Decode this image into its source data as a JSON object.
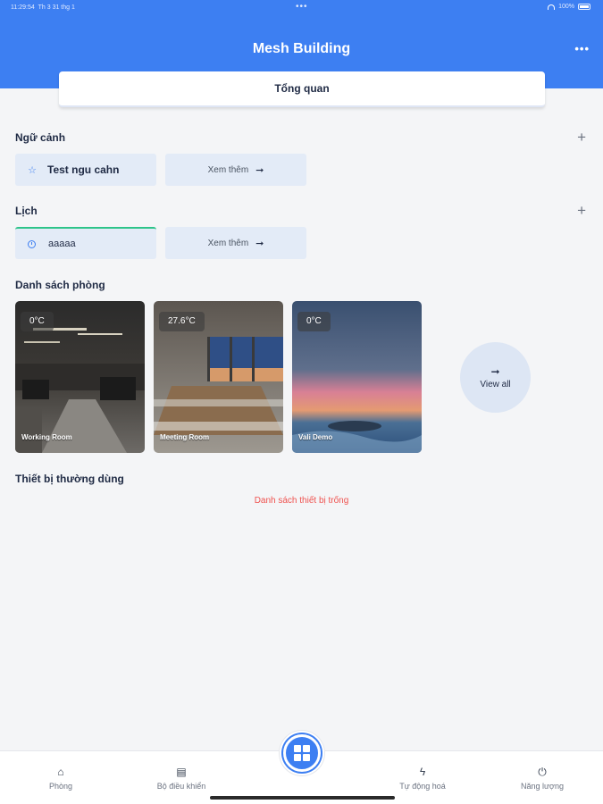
{
  "status_bar": {
    "time": "11:29:54",
    "date": "Th 3 31 thg 1",
    "battery": "100%"
  },
  "header": {
    "title": "Mesh Building"
  },
  "tab": {
    "label": "Tổng quan"
  },
  "scenes": {
    "title": "Ngữ cảnh",
    "item_label": "Test ngu cahn",
    "more_label": "Xem thêm"
  },
  "schedule": {
    "title": "Lịch",
    "item_label": "aaaaa",
    "more_label": "Xem thêm"
  },
  "rooms": {
    "title": "Danh sách phòng",
    "items": [
      {
        "temp": "0°C",
        "name": "Working Room"
      },
      {
        "temp": "27.6°C",
        "name": "Meeting Room"
      },
      {
        "temp": "0°C",
        "name": "Vali Demo"
      }
    ],
    "view_all": "View all"
  },
  "devices": {
    "title": "Thiết bị thường dùng",
    "empty_message": "Danh sách thiết bị trống"
  },
  "bottom_nav": {
    "items": [
      {
        "label": "Phòng",
        "icon": "home-icon"
      },
      {
        "label": "Bộ điều khiển",
        "icon": "remote-icon"
      },
      {
        "label": "Tự động hoá",
        "icon": "automation-icon"
      },
      {
        "label": "Năng lượng",
        "icon": "power-icon"
      }
    ],
    "fab_icon": "dashboard-icon"
  },
  "colors": {
    "primary": "#3d7ff2",
    "chip_bg": "#e3ebf7",
    "error": "#ef5350",
    "accent_green": "#2ec48a"
  }
}
